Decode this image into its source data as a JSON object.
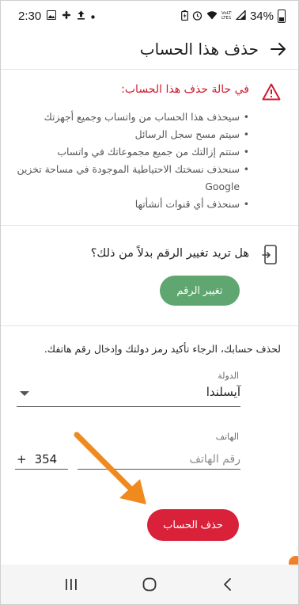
{
  "status_bar": {
    "time": "2:30",
    "battery_percent": "34%"
  },
  "header": {
    "title": "حذف هذا الحساب",
    "back_icon": "arrow-right-icon"
  },
  "warning": {
    "heading": "في حالة حذف هذا الحساب:",
    "items": [
      "سيحذف هذا الحساب من واتساب وجميع أجهزتك",
      "سيتم مسح سجل الرسائل",
      "ستتم إزالتك من جميع مجموعاتك في واتساب",
      "سنحذف نسختك الاحتياطية الموجودة في مساحة تخزين Google",
      "سنحذف أي قنوات أنشأتها"
    ],
    "icon": "warning-triangle-icon"
  },
  "change_number": {
    "question": "هل تريد تغيير الرقم بدلاً من ذلك؟",
    "button_label": "تغيير الرقم",
    "icon": "phone-transfer-icon"
  },
  "delete_form": {
    "intro": "لحذف حسابك، الرجاء تأكيد رمز دولتك وإدخال رقم هاتفك.",
    "country_label": "الدولة",
    "country_value": "آيسلندا",
    "phone_label": "الهاتف",
    "country_code_plus": "+",
    "country_code": "354",
    "phone_placeholder": "رقم الهاتف",
    "phone_value": "",
    "delete_button_label": "حذف الحساب"
  },
  "colors": {
    "danger": "#d9223a",
    "warning_text": "#d11a2f",
    "change_button": "#5fa670",
    "tutorial_arrow": "#f0891e"
  },
  "nav_bar": {
    "recents_icon": "recents-icon",
    "home_icon": "home-icon",
    "back_icon": "back-chevron-icon"
  }
}
